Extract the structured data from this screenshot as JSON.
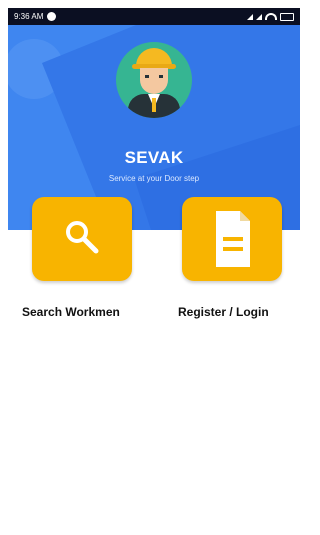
{
  "status_bar": {
    "time": "9:36 AM"
  },
  "header": {
    "title": "SEVAK",
    "subtitle": "Service at your Door step"
  },
  "actions": [
    {
      "label": "Search Workmen",
      "icon": "search-icon"
    },
    {
      "label": "Register / Login",
      "icon": "document-icon"
    }
  ],
  "colors": {
    "primary_blue": "#3f86f0",
    "accent_yellow": "#f8b400",
    "avatar_green": "#36b592"
  }
}
